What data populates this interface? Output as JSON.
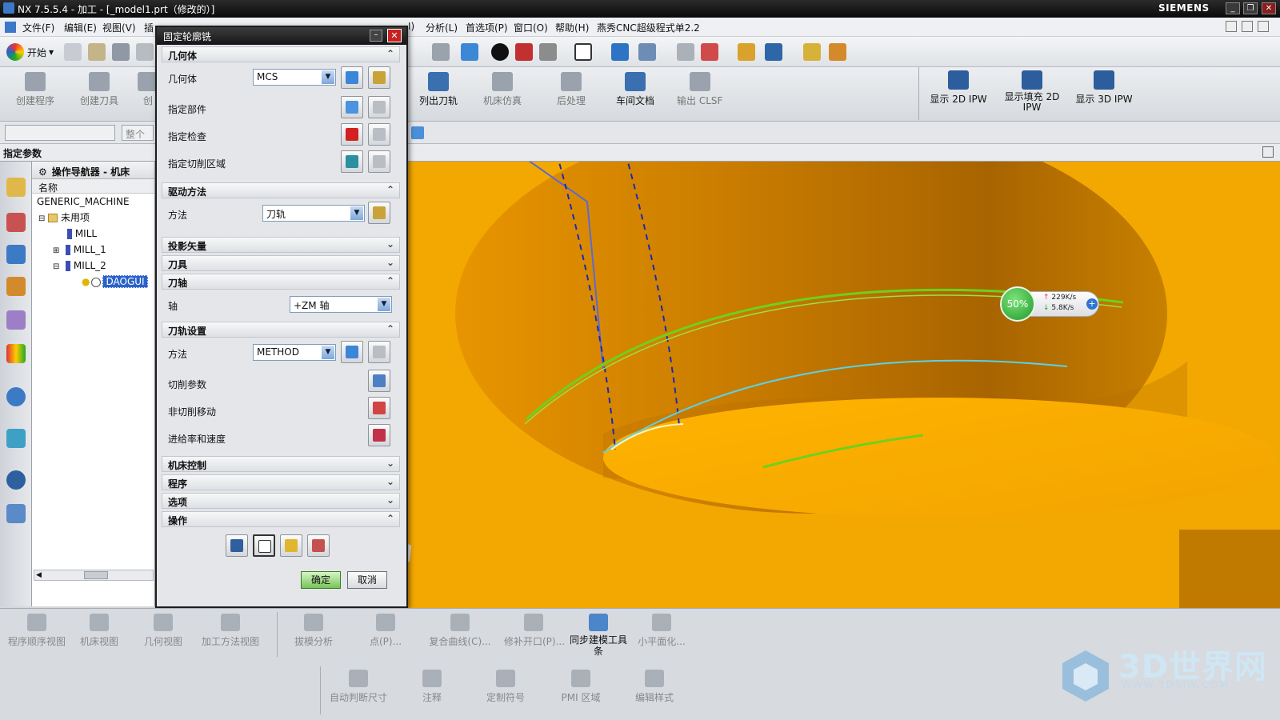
{
  "titlebar": {
    "title": "NX 7.5.5.4 - 加工 - [_model1.prt（修改的）]",
    "brand": "SIEMENS",
    "controls": [
      "_",
      "❐",
      "✕"
    ]
  },
  "menubar": {
    "items": [
      "文件(F)",
      "编辑(E)",
      "视图(V)",
      "插"
    ],
    "items_right": [
      "I)",
      "分析(L)",
      "首选项(P)",
      "窗口(O)",
      "帮助(H)",
      "燕秀CNC超级程式单2.2"
    ]
  },
  "toolbar": {
    "start": "开始"
  },
  "ribbon": {
    "left": [
      "创建程序",
      "创建刀具",
      "创"
    ],
    "right": [
      {
        "label": "列出刀轨",
        "on": true
      },
      {
        "label": "机床仿真",
        "on": false
      },
      {
        "label": "后处理",
        "on": false
      },
      {
        "label": "车间文档",
        "on": true
      },
      {
        "label": "输出 CLSF",
        "on": false
      }
    ],
    "ipw": [
      "显示 2D IPW",
      "显示填充 2D IPW",
      "显示 3D IPW"
    ]
  },
  "selbar": {
    "filter_placeholder": "整个"
  },
  "statusbar": {
    "text": "指定参数"
  },
  "navigator": {
    "title": "操作导航器 - 机床",
    "column": "名称",
    "nodes": [
      {
        "label": "GENERIC_MACHINE",
        "indent": 0,
        "expander": ""
      },
      {
        "label": "未用项",
        "indent": 1,
        "expander": "⊟"
      },
      {
        "label": "MILL",
        "indent": 2,
        "expander": ""
      },
      {
        "label": "MILL_1",
        "indent": 2,
        "expander": "⊞"
      },
      {
        "label": "MILL_2",
        "indent": 2,
        "expander": "⊟"
      },
      {
        "label": "DAOGUI",
        "indent": 3,
        "expander": "",
        "selected": true
      }
    ]
  },
  "dialog": {
    "title": "固定轮廓铣",
    "sections": {
      "geometry": "几何体",
      "drive": "驱动方法",
      "projection": "投影矢量",
      "tool": "刀具",
      "axis": "刀轴",
      "path": "刀轨设置",
      "machine": "机床控制",
      "program": "程序",
      "options": "选项",
      "actions": "操作"
    },
    "geometry": {
      "label": "几何体",
      "value": "MCS",
      "specify_part": "指定部件",
      "specify_check": "指定检查",
      "specify_cut_area": "指定切削区域"
    },
    "drive": {
      "label": "方法",
      "value": "刀轨"
    },
    "axis": {
      "label": "轴",
      "value": "+ZM 轴"
    },
    "path": {
      "label": "方法",
      "value": "METHOD",
      "cut_params": "切削参数",
      "non_cut": "非切削移动",
      "feeds": "进给率和速度"
    },
    "ok": "确定",
    "cancel": "取消"
  },
  "speed_widget": {
    "percent": "50%",
    "up": "229K/s",
    "down": "5.8K/s"
  },
  "bottom": {
    "row1": [
      {
        "label": "程序顺序视图",
        "on": false
      },
      {
        "label": "机床视图",
        "on": false
      },
      {
        "label": "几何视图",
        "on": false
      },
      {
        "label": "加工方法视图",
        "on": false
      },
      {
        "label": "拔模分析",
        "on": false
      },
      {
        "label": "点(P)...",
        "on": false
      },
      {
        "label": "复合曲线(C)...",
        "on": false
      },
      {
        "label": "修补开口(P)...",
        "on": false
      },
      {
        "label": "同步建模工具条",
        "on": true
      },
      {
        "label": "小平面化...",
        "on": false
      }
    ],
    "row2": [
      "自动判断尺寸",
      "注释",
      "定制符号",
      "PMI 区域",
      "编辑样式"
    ]
  },
  "watermark": {
    "name": "3D世界网",
    "url": "WWW.3DSJW.COM"
  },
  "colors": {
    "model": "#f2a800",
    "cavity": "#c77a00",
    "toolpath_green": "#6fd11a",
    "toolpath_cyan": "#5ad2e6",
    "toolpath_blue": "#1a2ab0"
  }
}
